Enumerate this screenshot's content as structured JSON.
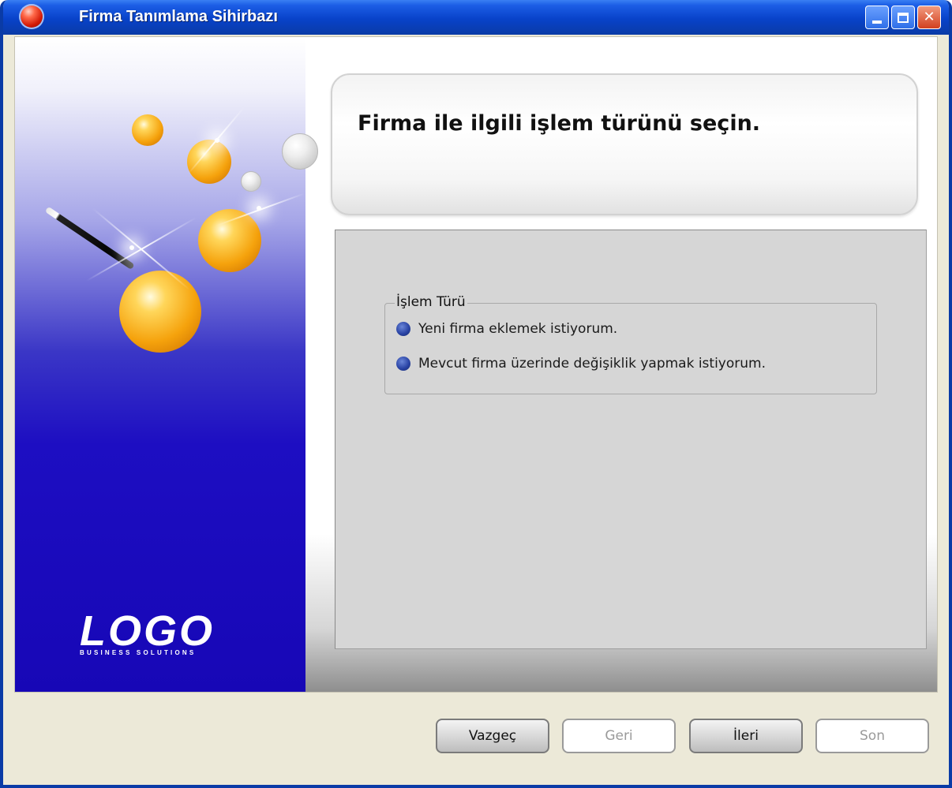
{
  "window": {
    "title": "Firma Tanımlama Sihirbazı"
  },
  "heading": "Firma ile ilgili işlem türünü seçin.",
  "branding": {
    "logo": "LOGO",
    "tagline": "BUSINESS SOLUTIONS"
  },
  "group": {
    "title": "İşlem Türü",
    "options": [
      {
        "label": "Yeni firma eklemek istiyorum."
      },
      {
        "label": "Mevcut firma üzerinde değişiklik yapmak istiyorum."
      }
    ]
  },
  "buttons": {
    "cancel": {
      "label": "Vazgeç",
      "enabled": true
    },
    "back": {
      "label": "Geri",
      "enabled": false
    },
    "next": {
      "label": "İleri",
      "enabled": true
    },
    "finish": {
      "label": "Son",
      "enabled": false
    }
  },
  "colors": {
    "titlebar": "#0a3ba6",
    "panel_bg": "#d6d6d6",
    "radio": "#2b45a6",
    "art_blue": "#1707b6",
    "sphere": "#f5a20c"
  },
  "icons": [
    "app-orb-icon",
    "minimize-icon",
    "maximize-icon",
    "close-icon"
  ]
}
